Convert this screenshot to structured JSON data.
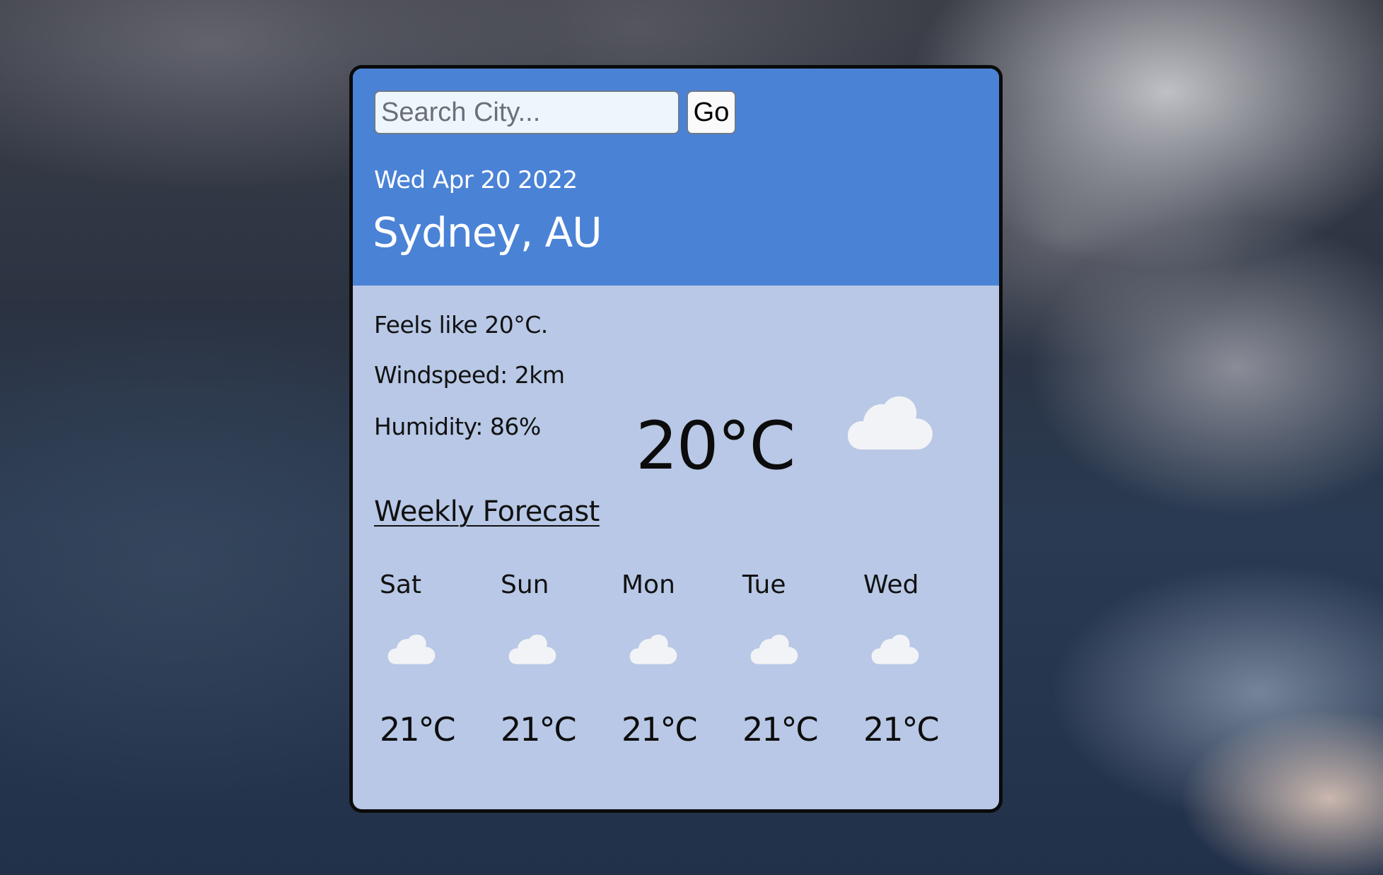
{
  "search": {
    "placeholder": "Search City...",
    "value": "",
    "button_label": "Go"
  },
  "current": {
    "date": "Wed Apr 20 2022",
    "location": "Sydney, AU",
    "feels_like": "Feels like 20°C.",
    "windspeed": "Windspeed: 2km",
    "humidity": "Humidity: 86%",
    "temperature": "20°C",
    "icon": "cloud-icon"
  },
  "weekly": {
    "title": "Weekly Forecast",
    "days": [
      {
        "day": "Sat",
        "icon": "cloud-icon",
        "temp": "21°C"
      },
      {
        "day": "Sun",
        "icon": "cloud-icon",
        "temp": "21°C"
      },
      {
        "day": "Mon",
        "icon": "cloud-icon",
        "temp": "21°C"
      },
      {
        "day": "Tue",
        "icon": "cloud-icon",
        "temp": "21°C"
      },
      {
        "day": "Wed",
        "icon": "cloud-icon",
        "temp": "21°C"
      }
    ]
  },
  "colors": {
    "header": "#4a82d6",
    "body": "#b8c8e6",
    "border": "#0b0b0b"
  }
}
